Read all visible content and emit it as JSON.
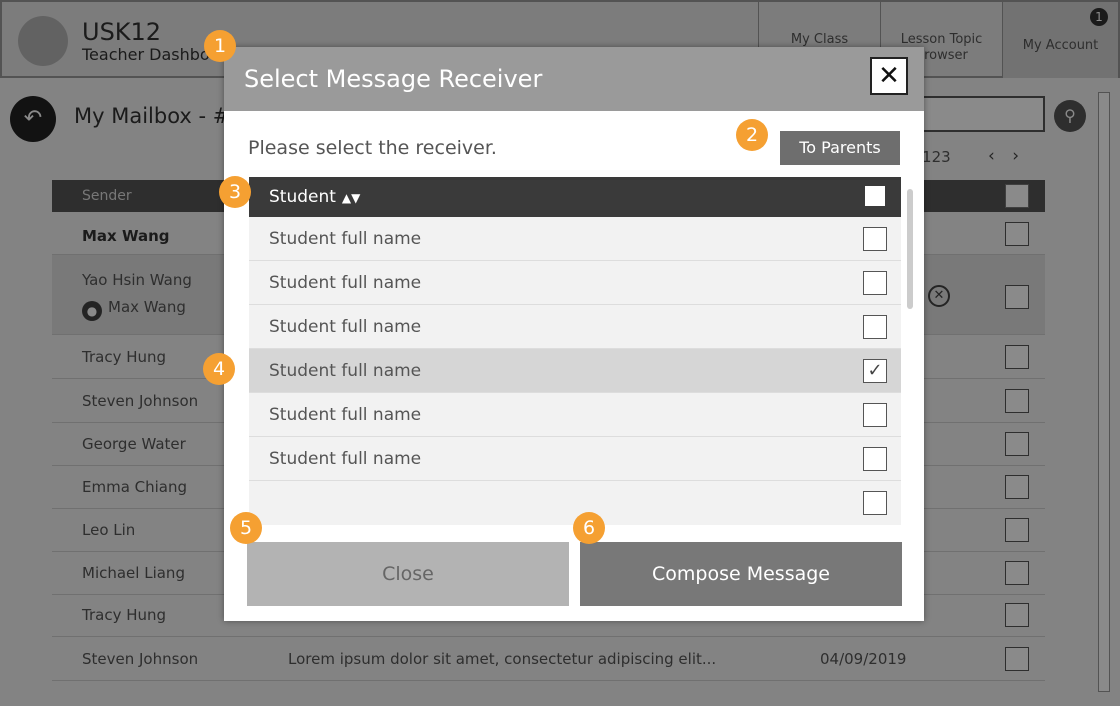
{
  "header": {
    "app_name": "USK12",
    "app_subtitle": "Teacher Dashboard",
    "tabs": [
      {
        "label": "My Class"
      },
      {
        "label": "Lesson Topic Browser"
      },
      {
        "label": "My Account"
      }
    ],
    "notification_count": "1"
  },
  "page": {
    "title": "My Mailbox - #",
    "pager_text": "f 123",
    "pager_arrows": "‹ ›",
    "column_sender": "Sender"
  },
  "mail_rows": [
    {
      "sender": "Max Wang"
    },
    {
      "sender": "Yao Hsin Wang",
      "sub": "Max Wang"
    },
    {
      "sender": "Tracy Hung"
    },
    {
      "sender": "Steven Johnson"
    },
    {
      "sender": "George Water"
    },
    {
      "sender": "Emma Chiang"
    },
    {
      "sender": "Leo Lin"
    },
    {
      "sender": "Michael Liang"
    },
    {
      "sender": "Tracy Hung"
    },
    {
      "sender": "Steven Johnson",
      "preview": "Lorem ipsum dolor sit amet, consectetur adipiscing elit...",
      "date": "04/09/2019"
    }
  ],
  "modal": {
    "title": "Select Message Receiver",
    "close_icon": "✕",
    "instruction": "Please select the receiver.",
    "to_parents_label": "To Parents",
    "column_label": "Student",
    "sort_icon": "▲▼",
    "rows": [
      {
        "name": "Student full name",
        "checked": false
      },
      {
        "name": "Student full name",
        "checked": false
      },
      {
        "name": "Student full name",
        "checked": false
      },
      {
        "name": "Student full name",
        "checked": true
      },
      {
        "name": "Student full name",
        "checked": false
      },
      {
        "name": "Student full name",
        "checked": false
      },
      {
        "name": "",
        "checked": false
      }
    ],
    "close_label": "Close",
    "compose_label": "Compose Message"
  },
  "annotations": [
    "1",
    "2",
    "3",
    "4",
    "5",
    "6"
  ],
  "colors": {
    "annotation": "#f5a032",
    "header_bar": "#3a3a3a",
    "compose_button": "#787878",
    "close_button": "#b3b3b3"
  }
}
